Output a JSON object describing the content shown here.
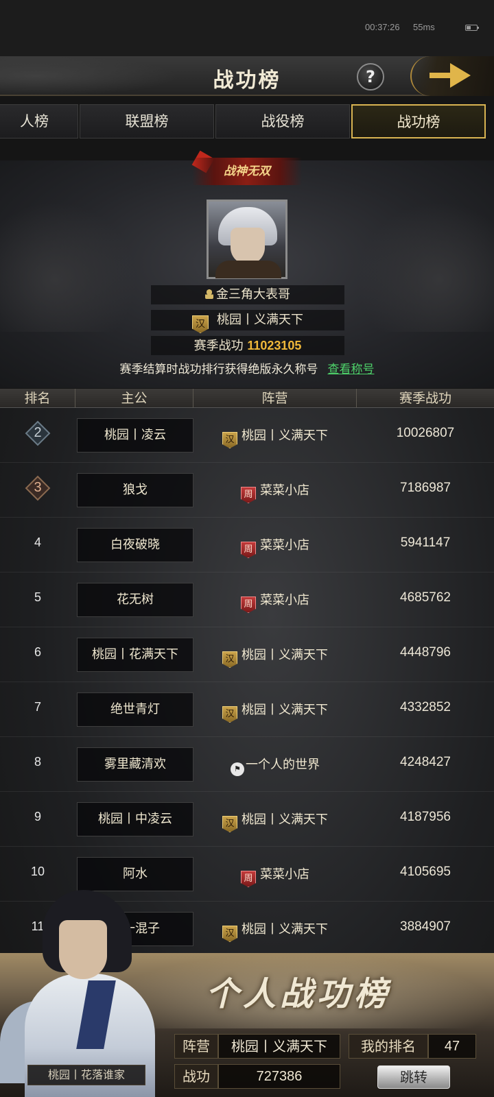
{
  "status_bar": {
    "time": "00:37:26",
    "signal": "55ms"
  },
  "header": {
    "title": "战功榜",
    "help_icon": "?"
  },
  "tabs": [
    {
      "label": "人榜",
      "active": false
    },
    {
      "label": "联盟榜",
      "active": false
    },
    {
      "label": "战役榜",
      "active": false
    },
    {
      "label": "战功榜",
      "active": true
    }
  ],
  "champion": {
    "title_badge": "战神无双",
    "name": "金三角大表哥",
    "camp_badge": "汉",
    "camp": "桃园丨义满天下",
    "season_label": "赛季战功",
    "season_value": "11023105",
    "note": "赛季结算时战功排行获得绝版永久称号",
    "view_link": "查看称号"
  },
  "table": {
    "headers": [
      "排名",
      "主公",
      "阵营",
      "赛季战功"
    ],
    "rows": [
      {
        "rank": "2",
        "lord": "桃园丨凌云",
        "camp_badge": "汉",
        "camp_type": "han",
        "camp": "桃园丨义满天下",
        "score": "10026807"
      },
      {
        "rank": "3",
        "lord": "狼戈",
        "camp_badge": "周",
        "camp_type": "zhou",
        "camp": "菜菜小店",
        "score": "7186987"
      },
      {
        "rank": "4",
        "lord": "白夜破晓",
        "camp_badge": "周",
        "camp_type": "zhou",
        "camp": "菜菜小店",
        "score": "5941147"
      },
      {
        "rank": "5",
        "lord": "花无树",
        "camp_badge": "周",
        "camp_type": "zhou",
        "camp": "菜菜小店",
        "score": "4685762"
      },
      {
        "rank": "6",
        "lord": "桃园丨花满天下",
        "camp_badge": "汉",
        "camp_type": "han",
        "camp": "桃园丨义满天下",
        "score": "4448796"
      },
      {
        "rank": "7",
        "lord": "绝世青灯",
        "camp_badge": "汉",
        "camp_type": "han",
        "camp": "桃园丨义满天下",
        "score": "4332852"
      },
      {
        "rank": "8",
        "lord": "雾里藏清欢",
        "camp_badge": "⚑",
        "camp_type": "flag",
        "camp": "一个人的世界",
        "score": "4248427"
      },
      {
        "rank": "9",
        "lord": "桃园丨中凌云",
        "camp_badge": "汉",
        "camp_type": "han",
        "camp": "桃园丨义满天下",
        "score": "4187956"
      },
      {
        "rank": "10",
        "lord": "阿水",
        "camp_badge": "周",
        "camp_type": "zhou",
        "camp": "菜菜小店",
        "score": "4105695"
      },
      {
        "rank": "11",
        "lord": "第一混子",
        "camp_badge": "汉",
        "camp_type": "han",
        "camp": "桃园丨义满天下",
        "score": "3884907"
      }
    ]
  },
  "personal": {
    "title": "个人战功榜",
    "hero_camp_tag": "桃园丨花落谁家",
    "camp_label": "阵营",
    "camp_value": "桃园丨义满天下",
    "rank_label": "我的排名",
    "rank_value": "47",
    "merit_label": "战功",
    "merit_value": "727386",
    "jump_button": "跳转"
  }
}
